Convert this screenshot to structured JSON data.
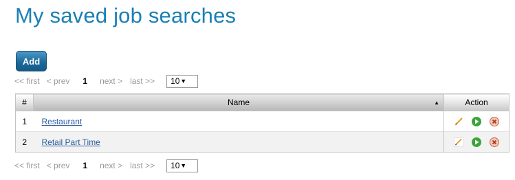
{
  "page": {
    "title": "My saved job searches"
  },
  "toolbar": {
    "add_label": "Add"
  },
  "pager": {
    "first": "<< first",
    "prev": "< prev",
    "current": "1",
    "next": "next >",
    "last": "last >>",
    "page_size": "10"
  },
  "table": {
    "headers": {
      "num": "#",
      "name": "Name",
      "action": "Action"
    },
    "rows": [
      {
        "num": "1",
        "name": "Restaurant"
      },
      {
        "num": "2",
        "name": "Retail Part Time"
      }
    ]
  },
  "colors": {
    "title": "#1a7fb4",
    "link": "#2a5d9f",
    "run": "#3aa53a",
    "delete": "#c96a50"
  },
  "icons": {
    "edit": "pencil-icon",
    "run": "play-icon",
    "delete": "delete-icon",
    "sort": "sort-asc-icon",
    "dropdown": "chevron-down-icon"
  }
}
